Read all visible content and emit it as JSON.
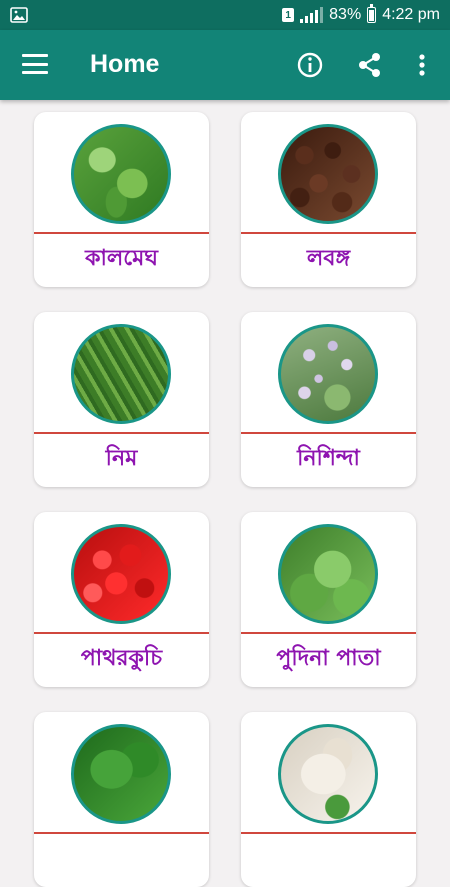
{
  "status_bar": {
    "battery": "83%",
    "time": "4:22 pm",
    "sim": "1",
    "icons": [
      "gallery-notification-icon",
      "sim-icon",
      "signal-icon",
      "battery-icon"
    ]
  },
  "app_bar": {
    "title": "Home",
    "icons": [
      "menu-icon",
      "info-icon",
      "share-icon",
      "more-vert-icon"
    ],
    "color": "#128477"
  },
  "herbs": [
    {
      "name": "কালমেঘ"
    },
    {
      "name": "লবঙ্গ"
    },
    {
      "name": "নিম"
    },
    {
      "name": "নিশিন্দা"
    },
    {
      "name": "পাথরকুচি"
    },
    {
      "name": "পুদিনা পাতা"
    },
    {
      "name": ""
    },
    {
      "name": ""
    }
  ],
  "colors": {
    "label": "#8e14b0",
    "divider": "#d0473d",
    "thumb_border": "#1a9688"
  }
}
